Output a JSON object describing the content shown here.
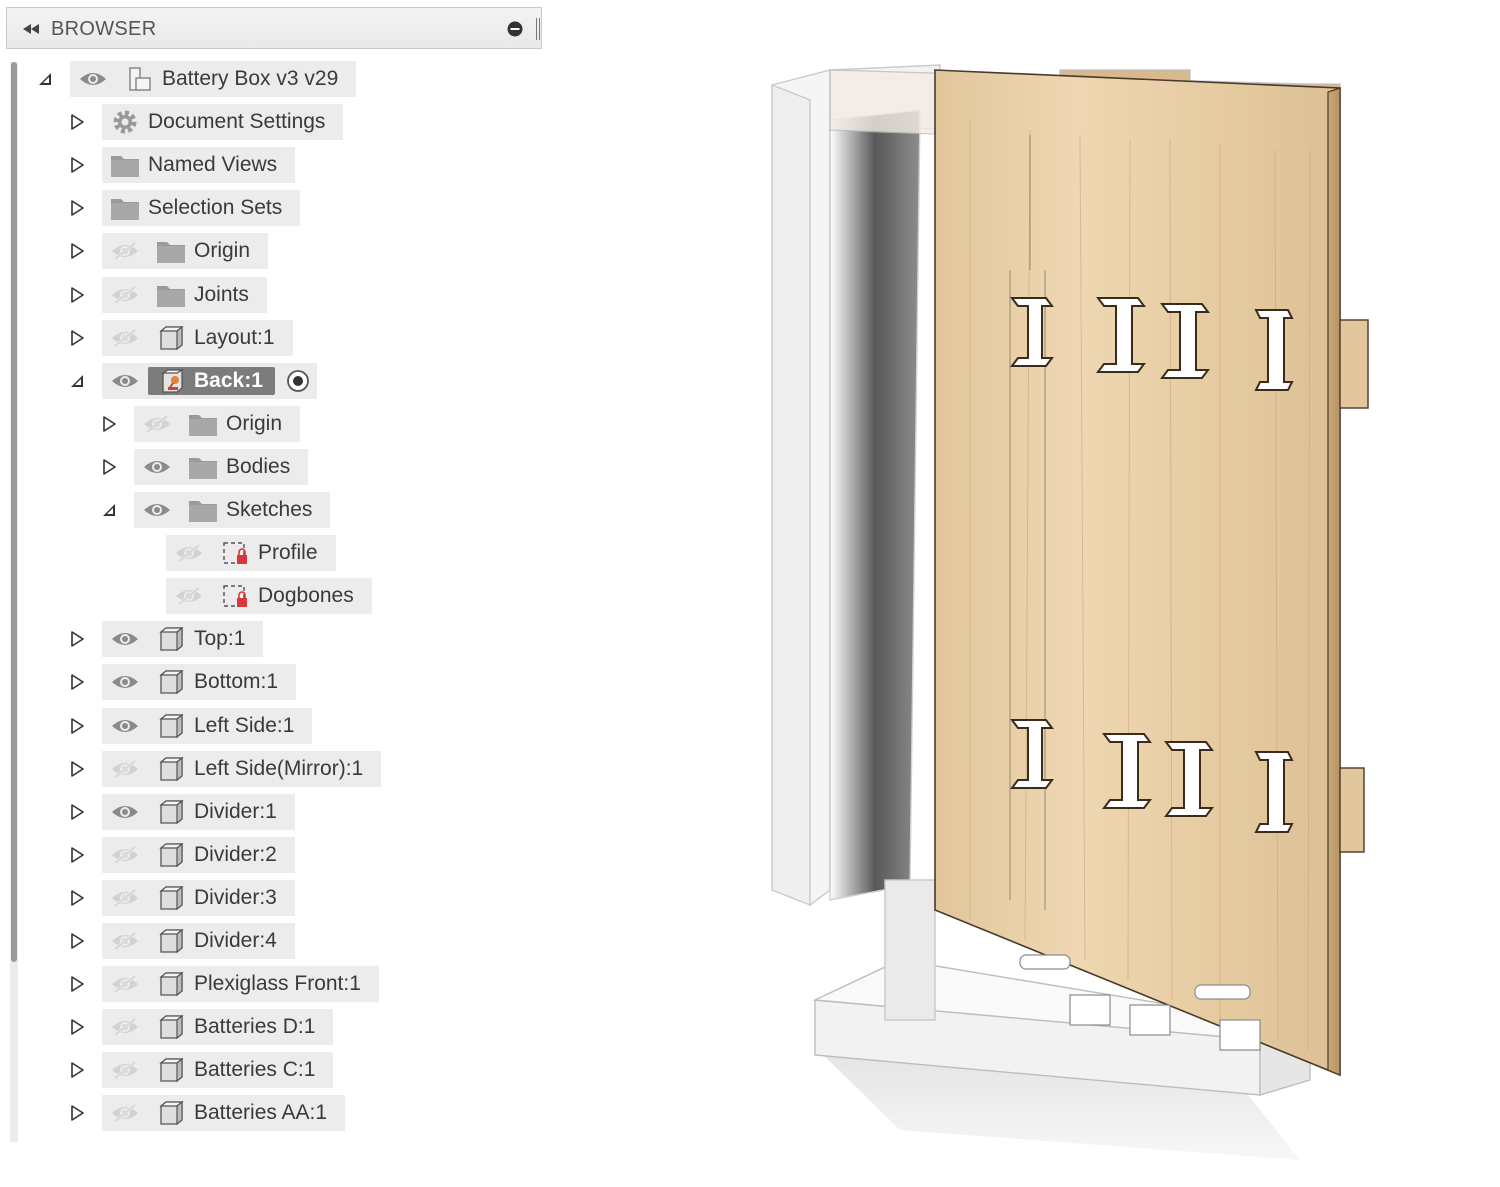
{
  "browser": {
    "title": "BROWSER"
  },
  "tree": [
    {
      "label": "Battery Box v3 v29",
      "depth": 0,
      "expanded": true,
      "eye": "visible",
      "icon": "document-icon"
    },
    {
      "label": "Document Settings",
      "depth": 1,
      "expanded": false,
      "eye": "none",
      "icon": "gear-icon"
    },
    {
      "label": "Named Views",
      "depth": 1,
      "expanded": false,
      "eye": "none",
      "icon": "folder-icon"
    },
    {
      "label": "Selection Sets",
      "depth": 1,
      "expanded": false,
      "eye": "none",
      "icon": "folder-icon"
    },
    {
      "label": "Origin",
      "depth": 1,
      "expanded": false,
      "eye": "hidden",
      "icon": "folder-icon"
    },
    {
      "label": "Joints",
      "depth": 1,
      "expanded": false,
      "eye": "hidden",
      "icon": "folder-icon"
    },
    {
      "label": "Layout:1",
      "depth": 1,
      "expanded": false,
      "eye": "hidden",
      "icon": "component-icon"
    },
    {
      "label": "Back:1",
      "depth": 1,
      "expanded": true,
      "eye": "visible",
      "icon": "active-component-icon",
      "active": true
    },
    {
      "label": "Origin",
      "depth": 2,
      "expanded": false,
      "eye": "hidden",
      "icon": "folder-icon"
    },
    {
      "label": "Bodies",
      "depth": 2,
      "expanded": false,
      "eye": "visible",
      "icon": "folder-icon"
    },
    {
      "label": "Sketches",
      "depth": 2,
      "expanded": true,
      "eye": "visible",
      "icon": "folder-icon"
    },
    {
      "label": "Profile",
      "depth": 3,
      "expanded": null,
      "eye": "hidden",
      "icon": "sketch-icon"
    },
    {
      "label": "Dogbones",
      "depth": 3,
      "expanded": null,
      "eye": "hidden",
      "icon": "sketch-icon"
    },
    {
      "label": "Top:1",
      "depth": 1,
      "expanded": false,
      "eye": "visible",
      "icon": "component-icon"
    },
    {
      "label": "Bottom:1",
      "depth": 1,
      "expanded": false,
      "eye": "visible",
      "icon": "component-icon"
    },
    {
      "label": "Left Side:1",
      "depth": 1,
      "expanded": false,
      "eye": "visible",
      "icon": "component-icon"
    },
    {
      "label": "Left Side(Mirror):1",
      "depth": 1,
      "expanded": false,
      "eye": "hidden",
      "icon": "component-icon"
    },
    {
      "label": "Divider:1",
      "depth": 1,
      "expanded": false,
      "eye": "visible",
      "icon": "component-icon"
    },
    {
      "label": "Divider:2",
      "depth": 1,
      "expanded": false,
      "eye": "hidden",
      "icon": "component-icon"
    },
    {
      "label": "Divider:3",
      "depth": 1,
      "expanded": false,
      "eye": "hidden",
      "icon": "component-icon"
    },
    {
      "label": "Divider:4",
      "depth": 1,
      "expanded": false,
      "eye": "hidden",
      "icon": "component-icon"
    },
    {
      "label": "Plexiglass Front:1",
      "depth": 1,
      "expanded": false,
      "eye": "hidden",
      "icon": "component-icon"
    },
    {
      "label": "Batteries D:1",
      "depth": 1,
      "expanded": false,
      "eye": "hidden",
      "icon": "component-icon"
    },
    {
      "label": "Batteries C:1",
      "depth": 1,
      "expanded": false,
      "eye": "hidden",
      "icon": "component-icon"
    },
    {
      "label": "Batteries AA:1",
      "depth": 1,
      "expanded": false,
      "eye": "hidden",
      "icon": "component-icon"
    }
  ],
  "colors": {
    "row_bg": "#ececec",
    "active_bg": "#7c7c7c",
    "wood": "#e8cfa6",
    "sketch_red": "#d9383a"
  }
}
